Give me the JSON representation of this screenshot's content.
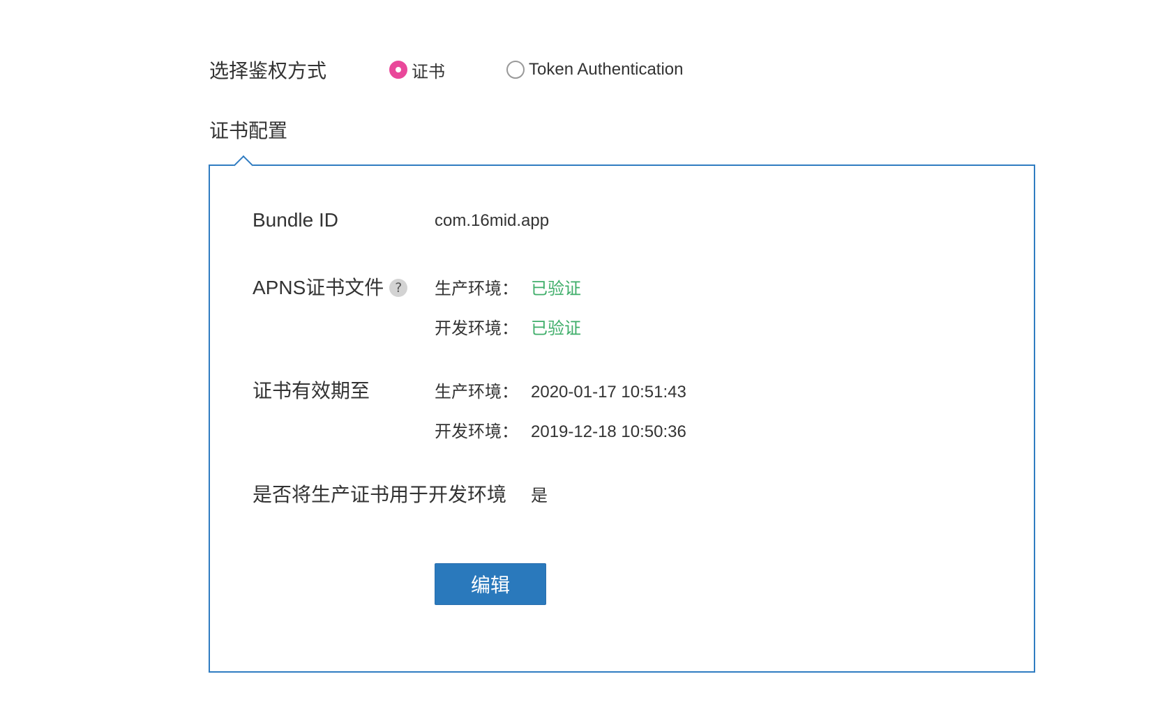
{
  "auth": {
    "label": "选择鉴权方式",
    "options": [
      {
        "label": "证书",
        "checked": true
      },
      {
        "label": "Token Authentication",
        "checked": false
      }
    ],
    "accent_color": "#e9489a"
  },
  "section": {
    "title": "证书配置"
  },
  "panel": {
    "border_color": "#2f7cc1",
    "bundle": {
      "label": "Bundle ID",
      "value": "com.16mid.app"
    },
    "apns": {
      "label": "APNS证书文件",
      "help_icon_text": "?",
      "production": {
        "env": "生产环境：",
        "status": "已验证"
      },
      "development": {
        "env": "开发环境：",
        "status": "已验证"
      },
      "status_color": "#3fae6a"
    },
    "validity": {
      "label": "证书有效期至",
      "production": {
        "env": "生产环境：",
        "date": "2020-01-17 10:51:43"
      },
      "development": {
        "env": "开发环境：",
        "date": "2019-12-18 10:50:36"
      }
    },
    "use_prod_for_dev": {
      "label": "是否将生产证书用于开发环境",
      "value": "是"
    },
    "edit_button": {
      "label": "编辑",
      "color": "#2a79bc"
    }
  }
}
